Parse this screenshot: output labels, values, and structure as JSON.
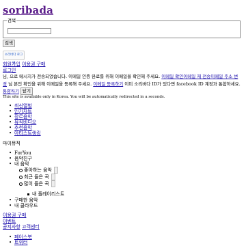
{
  "header": {
    "logo": "soribada"
  },
  "search": {
    "legend": "검색",
    "value": "",
    "button": "검색"
  },
  "login_badge": "소리바다 로그인",
  "account": {
    "join": "회원가입",
    "purchase": "이용권 구매",
    "login": "로그인"
  },
  "notice": {
    "part1": "님, 으로 메시지가 전송되었습니다. 이메일 인증 완료를 위해 이메일을 확인해 주세요.",
    "link1": "이메일 확인이메일 재 전송이메일 주소 변경",
    "part2": "님 본인 확인을 위해 이메일을 등록해 주세요.",
    "link2": "이메일 등록하기",
    "part3": "이미 소리바다 ID가 있다면 facebook ID 계정과 통합하세요.",
    "link3": "통합하기",
    "close": "닫기"
  },
  "redirect": "This site is available only in Korea. You will be automatically redirected in a seconds.",
  "nav": [
    "최신앨범",
    "인기차트",
    "장르음악",
    "뮤직비디오",
    "추천음악",
    "아티스트랭킹"
  ],
  "mymusic": {
    "title": "마이뮤직",
    "items": [
      "ForYou",
      "음악친구",
      "내 음악"
    ],
    "sub": [
      "좋아하는 음악",
      "최근 들은 곡",
      "많이 들은 곡"
    ],
    "playlist": "내 플레이리스트",
    "items2": [
      "구매한 음악",
      "내 클라우드"
    ]
  },
  "footer_links": [
    "이용권 구매",
    "이벤트",
    "공지사항",
    "고객센터"
  ],
  "social": [
    "페이스북",
    "트위터"
  ]
}
